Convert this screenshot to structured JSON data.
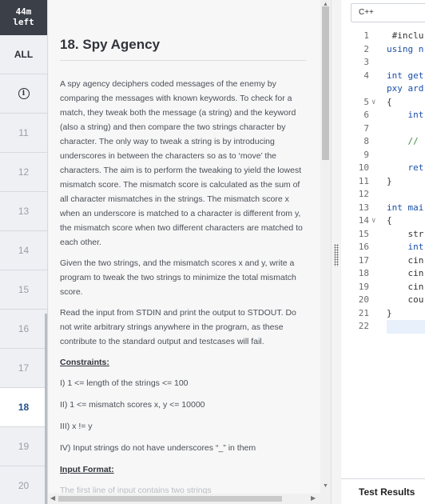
{
  "timer": {
    "line1": "44m",
    "line2": "left"
  },
  "nav": {
    "all_label": "ALL",
    "info_glyph": "i",
    "items": [
      {
        "label": "11"
      },
      {
        "label": "12"
      },
      {
        "label": "13"
      },
      {
        "label": "14"
      },
      {
        "label": "15"
      },
      {
        "label": "16"
      },
      {
        "label": "17"
      },
      {
        "label": "18",
        "active": true
      },
      {
        "label": "19"
      },
      {
        "label": "20"
      }
    ]
  },
  "problem": {
    "title": "18. Spy Agency",
    "paragraphs": [
      "A spy agency deciphers coded messages of the enemy by comparing the messages with known keywords. To check for a match, they tweak both the message (a string) and the keyword (also a string) and then compare the two strings character by character. The only way to tweak a string is by introducing underscores in between the characters so as to ‘move’ the characters. The aim is to perform the tweaking to yield the lowest mismatch score. The mismatch score is calculated as the sum of all character mismatches in the strings. The mismatch score x when an underscore is matched to a character is different from y, the mismatch score when two different characters are matched to each other.",
      "Given the two strings, and the mismatch scores x and y, write a program to tweak the two strings to minimize the total mismatch score.",
      "Read the input from STDIN and print the output to STDOUT. Do not write arbitrary strings anywhere in the program, as these contribute to the standard output and testcases will fail."
    ],
    "constraints_heading": "Constraints:",
    "constraints": [
      "I) 1 <= length of the strings <= 100",
      "II) 1 <= mismatch scores x, y <= 10000",
      "III) x != y",
      "IV) Input strings do not have underscores “_” in them"
    ],
    "input_heading": "Input Format:",
    "input_first_line": "The first line of input contains two strings"
  },
  "editor": {
    "language": "C++",
    "lines": [
      {
        "n": "1",
        "text": " #inclu",
        "cls": ""
      },
      {
        "n": "2",
        "text": "using n",
        "cls": "kw"
      },
      {
        "n": "3",
        "text": "",
        "cls": ""
      },
      {
        "n": "4",
        "text": "int get",
        "cls": "kw"
      },
      {
        "n": "",
        "text": "pxy ard",
        "cls": "kw"
      },
      {
        "n": "5",
        "text": "{",
        "cls": "",
        "fold": true
      },
      {
        "n": "6",
        "text": "    int",
        "cls": "kw"
      },
      {
        "n": "7",
        "text": "",
        "cls": ""
      },
      {
        "n": "8",
        "text": "    //",
        "cls": "cm"
      },
      {
        "n": "9",
        "text": "",
        "cls": ""
      },
      {
        "n": "10",
        "text": "    ret",
        "cls": "kw"
      },
      {
        "n": "11",
        "text": "}",
        "cls": ""
      },
      {
        "n": "12",
        "text": "",
        "cls": ""
      },
      {
        "n": "13",
        "text": "int mai",
        "cls": "kw"
      },
      {
        "n": "14",
        "text": "{",
        "cls": "",
        "fold": true
      },
      {
        "n": "15",
        "text": "    str",
        "cls": ""
      },
      {
        "n": "16",
        "text": "    int",
        "cls": "kw"
      },
      {
        "n": "17",
        "text": "    cin",
        "cls": ""
      },
      {
        "n": "18",
        "text": "    cin",
        "cls": ""
      },
      {
        "n": "19",
        "text": "    cin",
        "cls": ""
      },
      {
        "n": "20",
        "text": "    cou",
        "cls": ""
      },
      {
        "n": "21",
        "text": "}",
        "cls": ""
      },
      {
        "n": "22",
        "text": "",
        "cls": "",
        "current": true
      }
    ],
    "results_label": "Test Results"
  }
}
